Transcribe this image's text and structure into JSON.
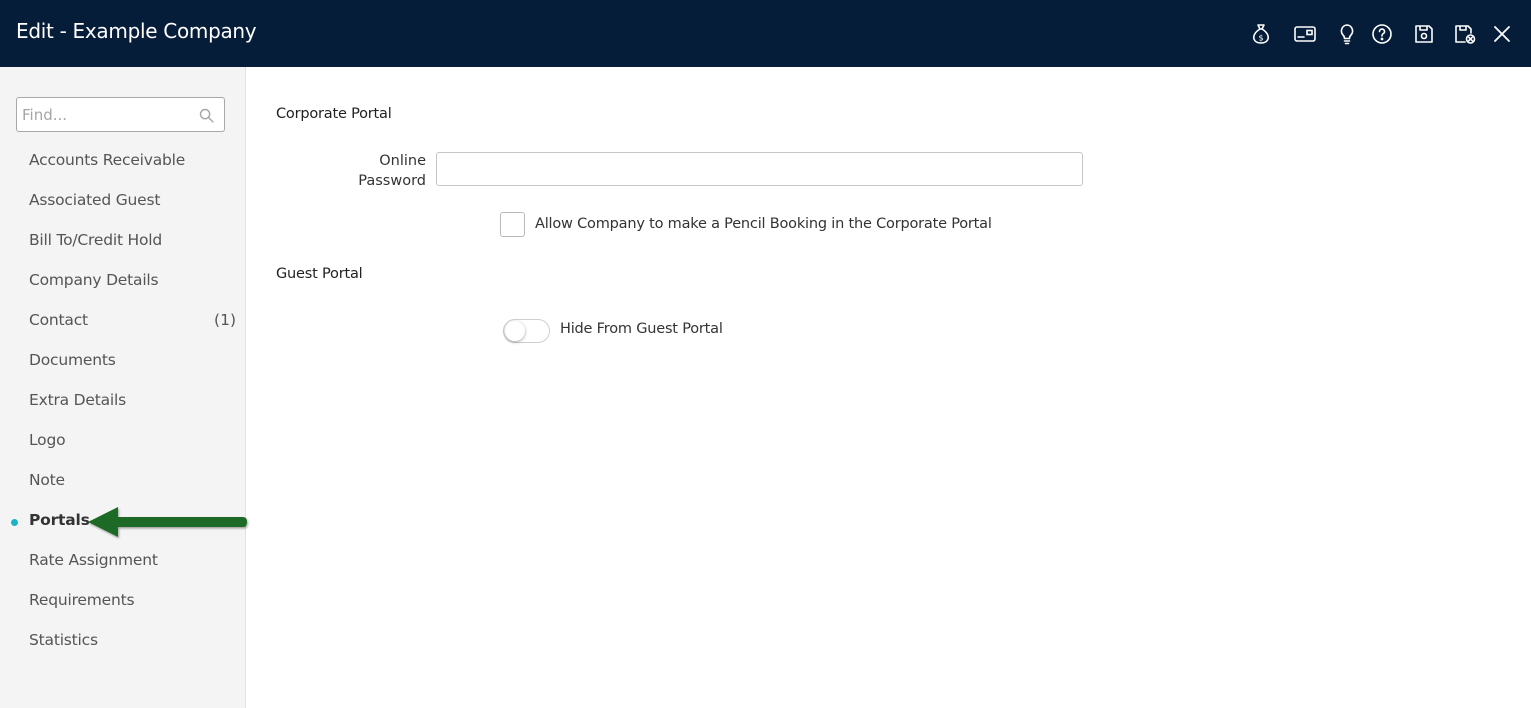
{
  "header": {
    "title": "Edit - Example Company",
    "icons": [
      "money-bag-icon",
      "card-icon",
      "lightbulb-icon",
      "help-icon",
      "save-icon",
      "save-close-icon",
      "close-icon"
    ],
    "background": "#061d3a"
  },
  "sidebar": {
    "search": {
      "placeholder": "Find...",
      "value": ""
    },
    "items": [
      {
        "label": "Accounts Receivable"
      },
      {
        "label": "Associated Guest"
      },
      {
        "label": "Bill To/Credit Hold"
      },
      {
        "label": "Company Details"
      },
      {
        "label": "Contact",
        "count": "(1)"
      },
      {
        "label": "Documents"
      },
      {
        "label": "Extra Details"
      },
      {
        "label": "Logo"
      },
      {
        "label": "Note"
      },
      {
        "label": "Portals",
        "active": true
      },
      {
        "label": "Rate Assignment"
      },
      {
        "label": "Requirements"
      },
      {
        "label": "Statistics"
      }
    ],
    "active_dot_color": "#1ab4c8",
    "arrow_color": "#1e6b25"
  },
  "main": {
    "corporate": {
      "title": "Corporate Portal",
      "password_label": "Online Password",
      "password_value": "",
      "pencil_booking_label": "Allow Company to make a Pencil Booking in the Corporate Portal",
      "pencil_booking_checked": false
    },
    "guest": {
      "title": "Guest Portal",
      "hide_label": "Hide From Guest Portal",
      "hide_enabled": false
    }
  }
}
